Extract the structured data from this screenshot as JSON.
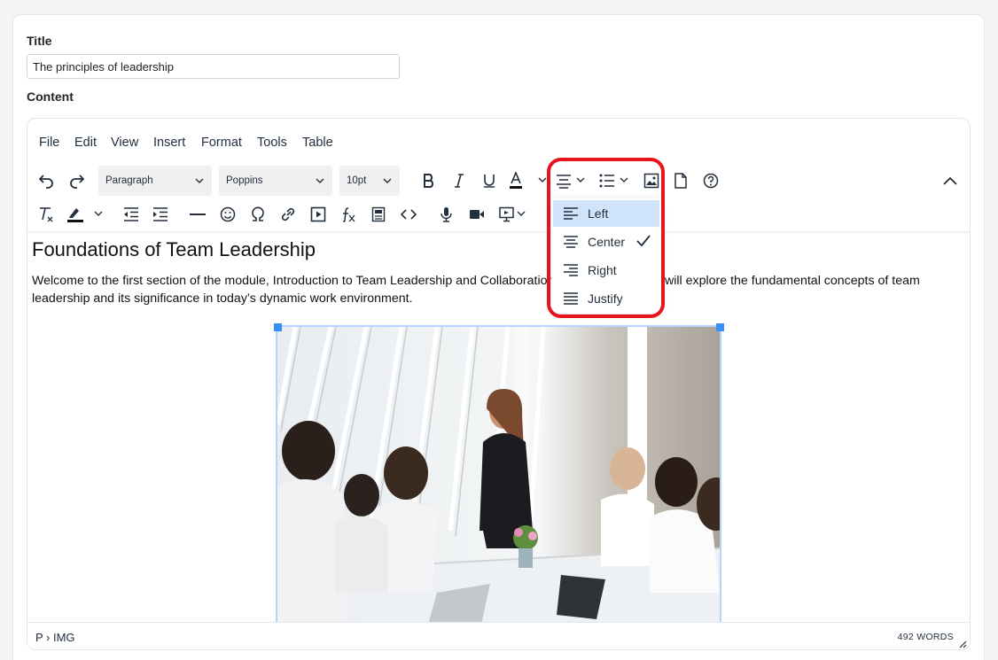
{
  "form": {
    "title_label": "Title",
    "title_value": "The principles of leadership",
    "content_label": "Content"
  },
  "menubar": {
    "file": "File",
    "edit": "Edit",
    "view": "View",
    "insert": "Insert",
    "format": "Format",
    "tools": "Tools",
    "table": "Table"
  },
  "toolbar": {
    "block_format": "Paragraph",
    "font_family": "Poppins",
    "font_size": "10pt",
    "icons_row1": [
      "undo-icon",
      "redo-icon",
      "bold-icon",
      "italic-icon",
      "underline-icon",
      "text-color-icon",
      "align-icon",
      "list-icon",
      "image-icon",
      "page-icon",
      "help-icon",
      "collapse-icon"
    ],
    "icons_row2": [
      "clear-format-icon",
      "highlight-icon",
      "outdent-icon",
      "indent-icon",
      "horizontal-rule-icon",
      "emoji-icon",
      "special-char-icon",
      "link-icon",
      "media-icon",
      "formula-icon",
      "template-icon",
      "code-icon",
      "voice-icon",
      "video-icon",
      "preview-icon"
    ]
  },
  "document": {
    "heading": "Foundations of Team Leadership",
    "paragraph": "Welcome to the first section of the module, Introduction to Team Leadership and Collaboration. In this section, we will explore the fundamental concepts of team leadership and its significance in today’s dynamic work environment."
  },
  "statusbar": {
    "path": "P › IMG",
    "word_count": "492 WORDS"
  },
  "align_dropdown": {
    "items": [
      {
        "label": "Left",
        "icon": "align-left-icon",
        "highlighted": true,
        "checked": false
      },
      {
        "label": "Center",
        "icon": "align-center-icon",
        "highlighted": false,
        "checked": true
      },
      {
        "label": "Right",
        "icon": "align-right-icon",
        "highlighted": false,
        "checked": false
      },
      {
        "label": "Justify",
        "icon": "align-justify-icon",
        "highlighted": false,
        "checked": false
      }
    ]
  },
  "colors": {
    "accent": "#3a8ff7",
    "highlight_ring": "#e8141b",
    "menu_active": "#cfe4fb"
  }
}
